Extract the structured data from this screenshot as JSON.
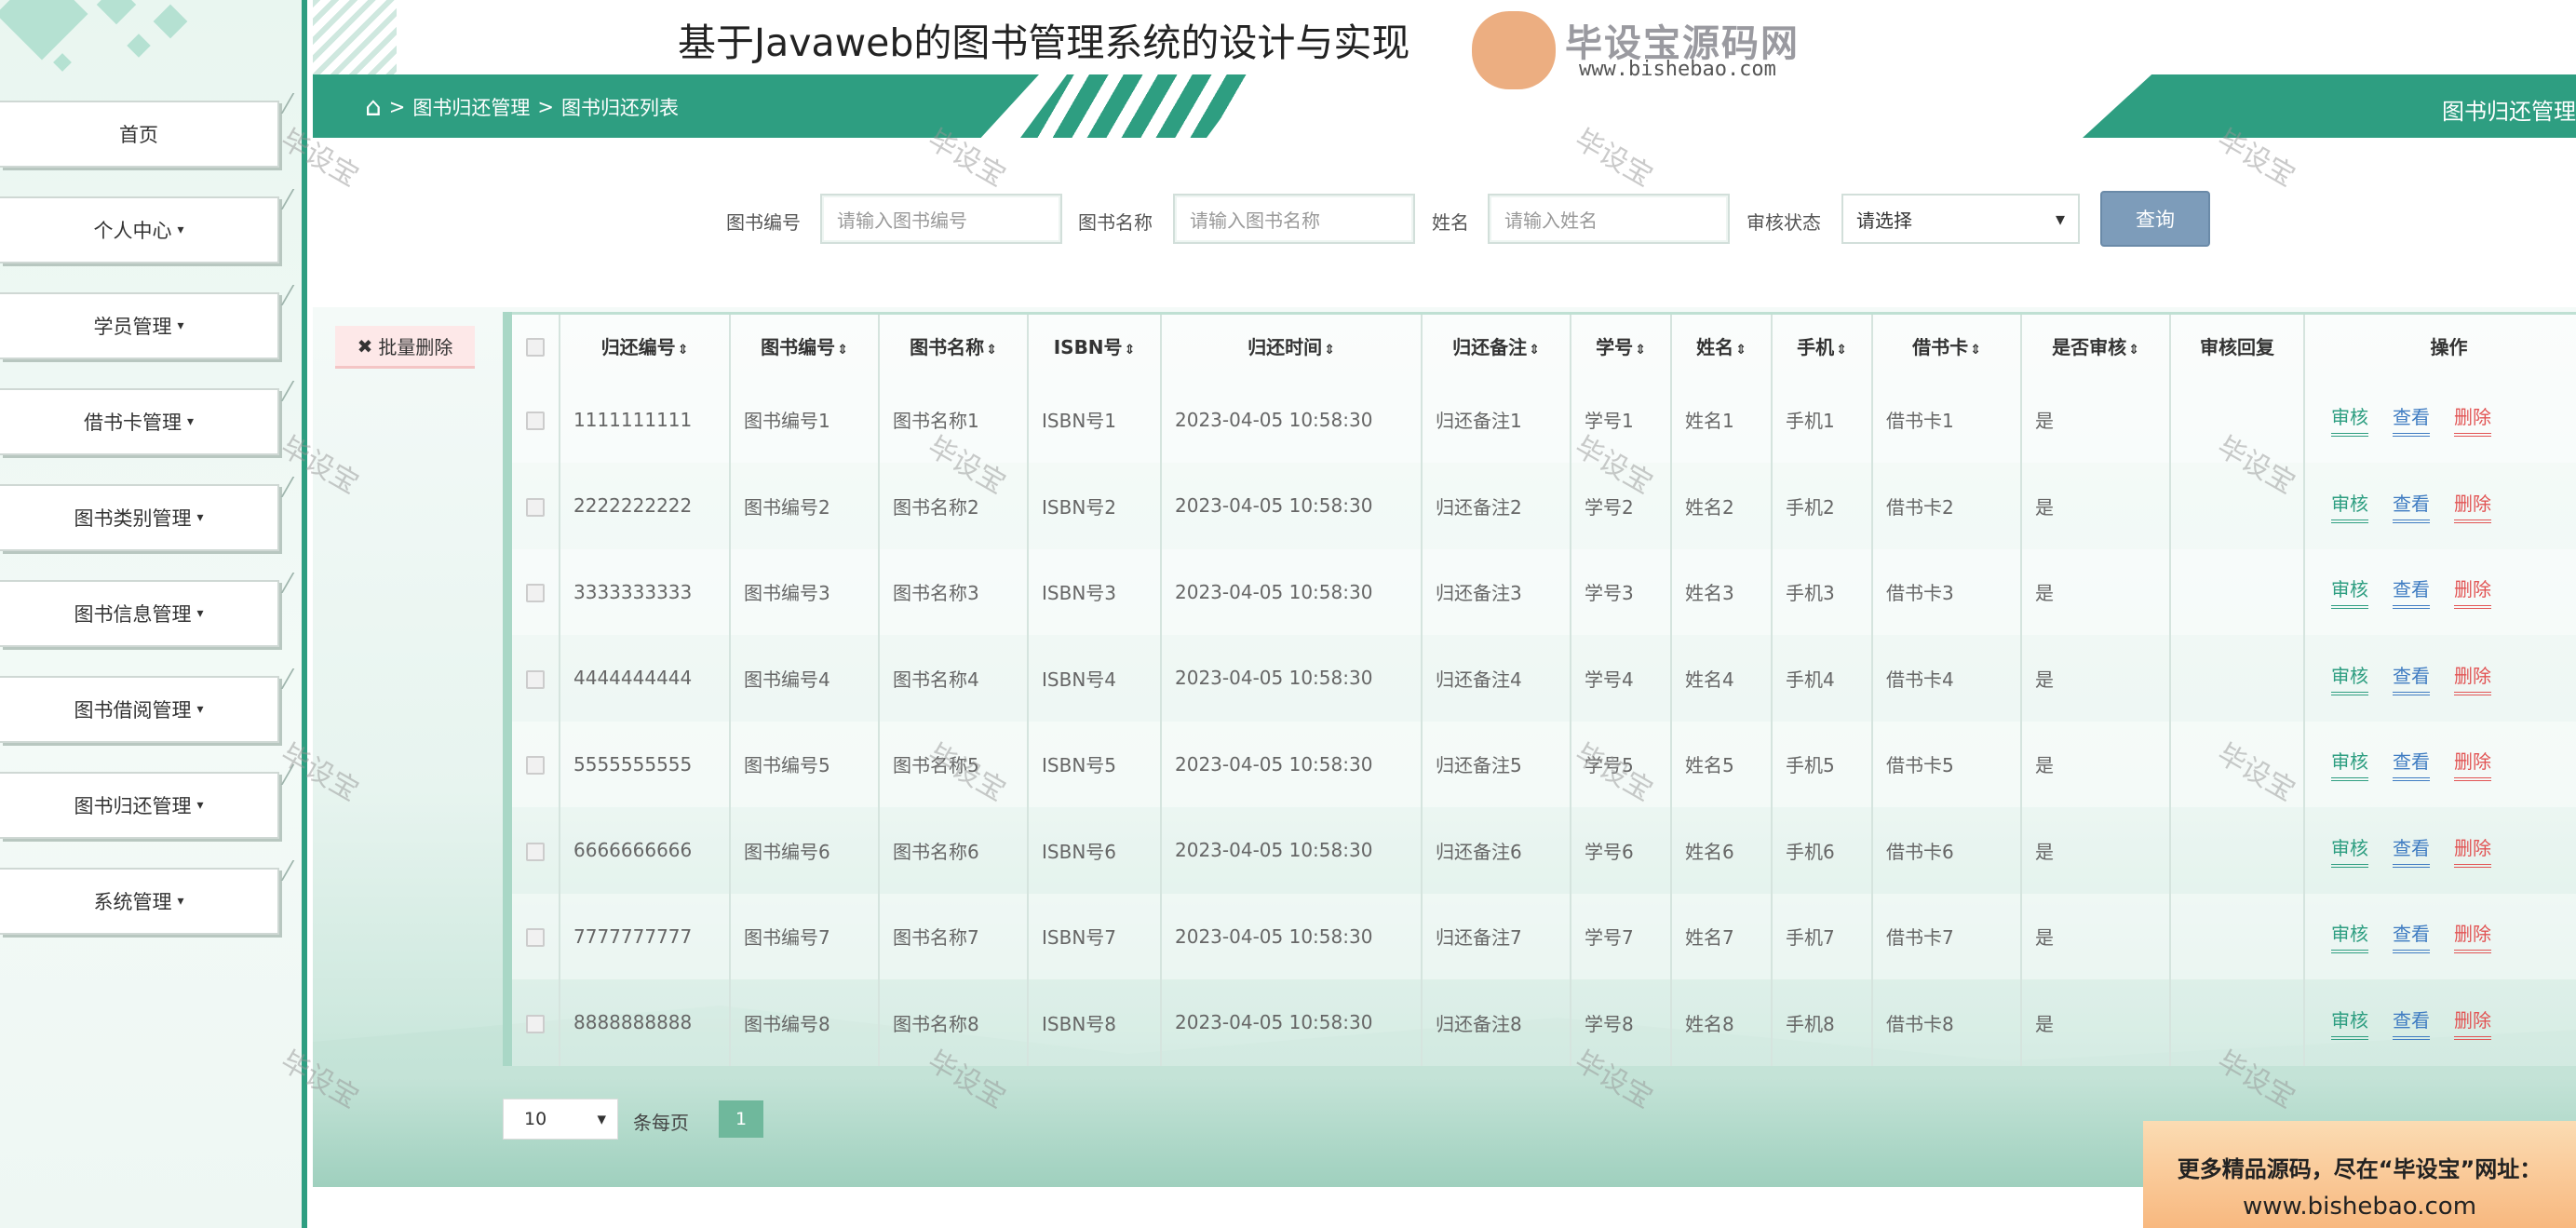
{
  "app": {
    "title": "基于Javaweb的图书管理系统的设计与实现",
    "watermark_logo_text": "毕设宝源码网",
    "watermark_url": "www.bishebao.com",
    "watermark_tag": "毕设宝"
  },
  "sidebar": {
    "items": [
      {
        "label": "首页",
        "caret": ""
      },
      {
        "label": "个人中心",
        "caret": "▾"
      },
      {
        "label": "学员管理",
        "caret": "▾"
      },
      {
        "label": "借书卡管理",
        "caret": "▾"
      },
      {
        "label": "图书类别管理",
        "caret": "▾"
      },
      {
        "label": "图书信息管理",
        "caret": "▾"
      },
      {
        "label": "图书借阅管理",
        "caret": "▾"
      },
      {
        "label": "图书归还管理",
        "caret": "▾"
      },
      {
        "label": "系统管理",
        "caret": "▾"
      }
    ]
  },
  "breadcrumb": {
    "home_icon": "⌂",
    "sep": ">",
    "level1": "图书归还管理",
    "level2": "图书归还列表",
    "right_title": "图书归还管理"
  },
  "search": {
    "book_no_label": "图书编号",
    "book_no_placeholder": "请输入图书编号",
    "book_name_label": "图书名称",
    "book_name_placeholder": "请输入图书名称",
    "name_label": "姓名",
    "name_placeholder": "请输入姓名",
    "status_label": "审核状态",
    "status_value": "请选择",
    "query_button": "查询"
  },
  "toolbar": {
    "batch_delete": "批量删除",
    "batch_delete_icon": "✖"
  },
  "table": {
    "sort_icon": "⇕",
    "columns": [
      "归还编号",
      "图书编号",
      "图书名称",
      "ISBN号",
      "归还时间",
      "归还备注",
      "学号",
      "姓名",
      "手机",
      "借书卡",
      "是否审核",
      "审核回复",
      "操作"
    ],
    "sortable": [
      true,
      true,
      true,
      true,
      true,
      true,
      true,
      true,
      true,
      true,
      true,
      false,
      false
    ],
    "actions": {
      "audit": "审核",
      "view": "查看",
      "delete": "删除"
    },
    "rows": [
      [
        "1111111111",
        "图书编号1",
        "图书名称1",
        "ISBN号1",
        "2023-04-05 10:58:30",
        "归还备注1",
        "学号1",
        "姓名1",
        "手机1",
        "借书卡1",
        "是",
        ""
      ],
      [
        "2222222222",
        "图书编号2",
        "图书名称2",
        "ISBN号2",
        "2023-04-05 10:58:30",
        "归还备注2",
        "学号2",
        "姓名2",
        "手机2",
        "借书卡2",
        "是",
        ""
      ],
      [
        "3333333333",
        "图书编号3",
        "图书名称3",
        "ISBN号3",
        "2023-04-05 10:58:30",
        "归还备注3",
        "学号3",
        "姓名3",
        "手机3",
        "借书卡3",
        "是",
        ""
      ],
      [
        "4444444444",
        "图书编号4",
        "图书名称4",
        "ISBN号4",
        "2023-04-05 10:58:30",
        "归还备注4",
        "学号4",
        "姓名4",
        "手机4",
        "借书卡4",
        "是",
        ""
      ],
      [
        "5555555555",
        "图书编号5",
        "图书名称5",
        "ISBN号5",
        "2023-04-05 10:58:30",
        "归还备注5",
        "学号5",
        "姓名5",
        "手机5",
        "借书卡5",
        "是",
        ""
      ],
      [
        "6666666666",
        "图书编号6",
        "图书名称6",
        "ISBN号6",
        "2023-04-05 10:58:30",
        "归还备注6",
        "学号6",
        "姓名6",
        "手机6",
        "借书卡6",
        "是",
        ""
      ],
      [
        "7777777777",
        "图书编号7",
        "图书名称7",
        "ISBN号7",
        "2023-04-05 10:58:30",
        "归还备注7",
        "学号7",
        "姓名7",
        "手机7",
        "借书卡7",
        "是",
        ""
      ],
      [
        "8888888888",
        "图书编号8",
        "图书名称8",
        "ISBN号8",
        "2023-04-05 10:58:30",
        "归还备注8",
        "学号8",
        "姓名8",
        "手机8",
        "借书卡8",
        "是",
        ""
      ]
    ]
  },
  "pager": {
    "page_size": "10",
    "per_page_label": "条每页",
    "current_page": "1"
  },
  "ad": {
    "line1": "更多精品源码，尽在“毕设宝”网址：",
    "line2": "www.bishebao.com"
  },
  "icons": {
    "fullscreen": "⤢",
    "user": "👤",
    "dropdown": "▾"
  },
  "colors": {
    "accent": "#2e9e81",
    "view_link": "#3f7cc2",
    "delete_link": "#e25454",
    "query_button": "#7d9cba"
  }
}
